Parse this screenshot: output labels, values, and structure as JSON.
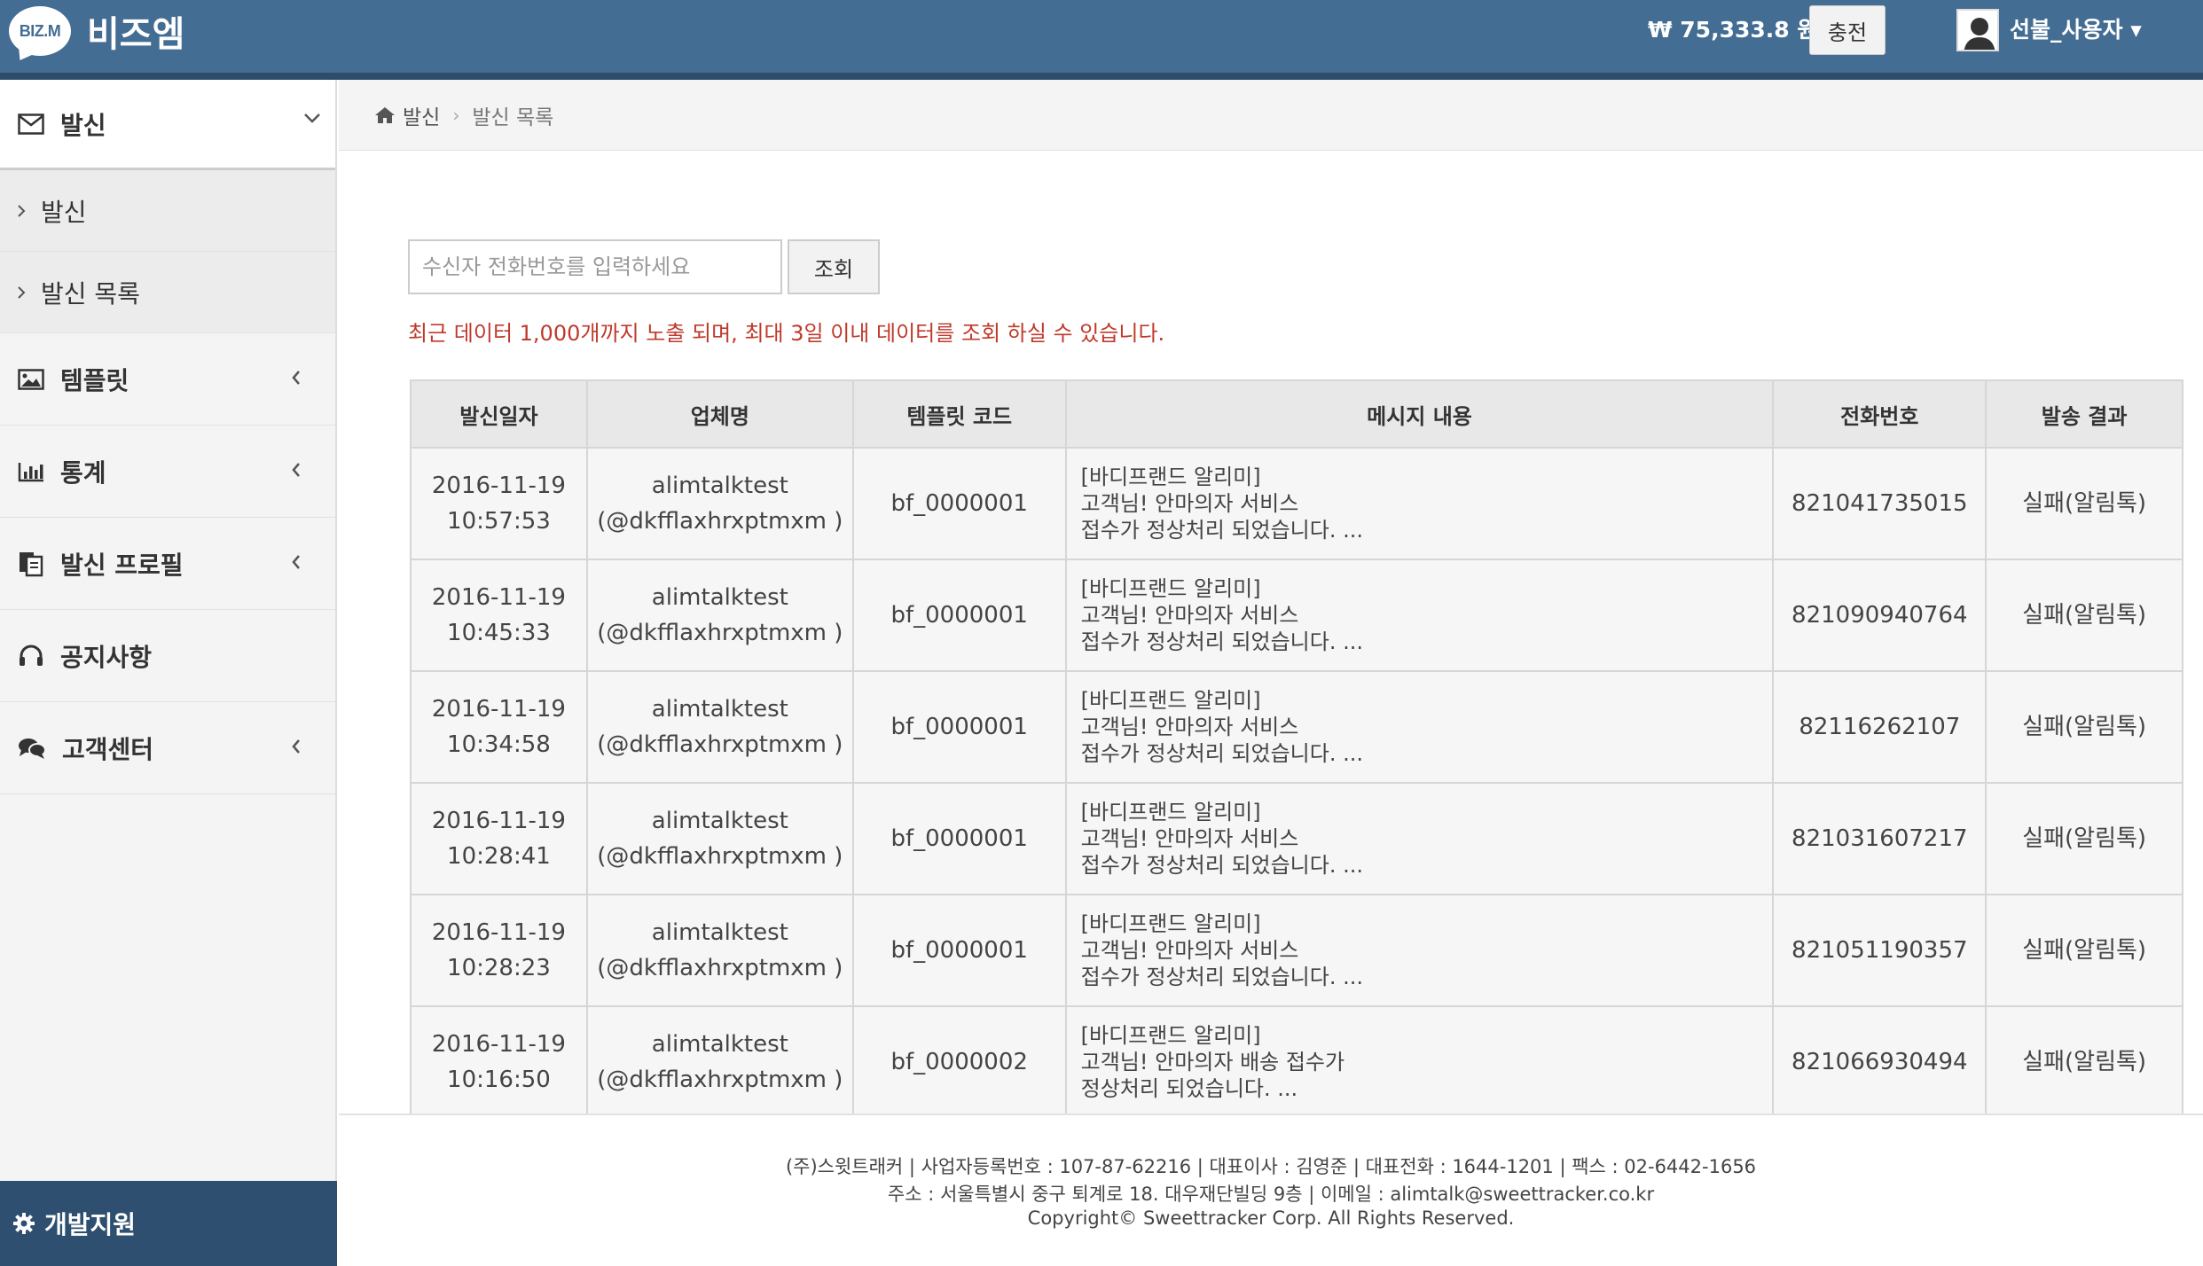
{
  "app": {
    "logo_mark": "BIZ.M",
    "logo_text": "비즈엠"
  },
  "header": {
    "balance": "₩ 75,333.8 원",
    "charge_label": "충전",
    "user_label": "선불_사용자 ▾"
  },
  "sidebar": {
    "send_section": {
      "label": "발신",
      "sub_items": [
        "발신",
        "발신 목록"
      ]
    },
    "items": [
      {
        "label": "템플릿",
        "icon": "image-icon",
        "has_chevron": true
      },
      {
        "label": "통계",
        "icon": "bar-chart-icon",
        "has_chevron": true
      },
      {
        "label": "발신 프로필",
        "icon": "document-icon",
        "has_chevron": true
      },
      {
        "label": "공지사항",
        "icon": "headset-icon",
        "has_chevron": false
      },
      {
        "label": "고객센터",
        "icon": "chat-icon",
        "has_chevron": true
      }
    ],
    "dev_support": "개발지원"
  },
  "breadcrumb": {
    "home": "발신",
    "current": "발신 목록"
  },
  "search": {
    "placeholder": "수신자 전화번호를 입력하세요",
    "button": "조회"
  },
  "notice": "최근 데이터 1,000개까지 노출 되며, 최대 3일 이내 데이터를 조회 하실 수 있습니다.",
  "table": {
    "columns": [
      "발신일자",
      "업체명",
      "템플릿 코드",
      "메시지 내용",
      "전화번호",
      "발송 결과"
    ],
    "rows": [
      {
        "date": "2016-11-19",
        "time": "10:57:53",
        "company": "alimtalktest",
        "company_id": "(@dkfflaxhrxptmxm )",
        "template": "bf_0000001",
        "msg1": "[바디프랜드 알리미]",
        "msg2": "고객님! 안마의자 서비스",
        "msg3": "접수가 정상처리 되었습니다. ...",
        "phone": "821041735015",
        "result": "실패(알림톡)"
      },
      {
        "date": "2016-11-19",
        "time": "10:45:33",
        "company": "alimtalktest",
        "company_id": "(@dkfflaxhrxptmxm )",
        "template": "bf_0000001",
        "msg1": "[바디프랜드 알리미]",
        "msg2": "고객님! 안마의자 서비스",
        "msg3": "접수가 정상처리 되었습니다. ...",
        "phone": "821090940764",
        "result": "실패(알림톡)"
      },
      {
        "date": "2016-11-19",
        "time": "10:34:58",
        "company": "alimtalktest",
        "company_id": "(@dkfflaxhrxptmxm )",
        "template": "bf_0000001",
        "msg1": "[바디프랜드 알리미]",
        "msg2": "고객님! 안마의자 서비스",
        "msg3": "접수가 정상처리 되었습니다. ...",
        "phone": "82116262107",
        "result": "실패(알림톡)"
      },
      {
        "date": "2016-11-19",
        "time": "10:28:41",
        "company": "alimtalktest",
        "company_id": "(@dkfflaxhrxptmxm )",
        "template": "bf_0000001",
        "msg1": "[바디프랜드 알리미]",
        "msg2": "고객님! 안마의자 서비스",
        "msg3": "접수가 정상처리 되었습니다. ...",
        "phone": "821031607217",
        "result": "실패(알림톡)"
      },
      {
        "date": "2016-11-19",
        "time": "10:28:23",
        "company": "alimtalktest",
        "company_id": "(@dkfflaxhrxptmxm )",
        "template": "bf_0000001",
        "msg1": "[바디프랜드 알리미]",
        "msg2": "고객님! 안마의자 서비스",
        "msg3": "접수가 정상처리 되었습니다. ...",
        "phone": "821051190357",
        "result": "실패(알림톡)"
      },
      {
        "date": "2016-11-19",
        "time": "10:16:50",
        "company": "alimtalktest",
        "company_id": "(@dkfflaxhrxptmxm )",
        "template": "bf_0000002",
        "msg1": "[바디프랜드 알리미]",
        "msg2": "고객님! 안마의자 배송 접수가",
        "msg3": "정상처리 되었습니다. ...",
        "phone": "821066930494",
        "result": "실패(알림톡)"
      }
    ]
  },
  "footer": {
    "line1": "(주)스윗트래커  |  사업자등록번호 : 107-87-62216  |  대표이사 : 김영준  |  대표전화 : 1644-1201  |  팩스 : 02-6442-1656",
    "line2": "주소 : 서울특별시 중구 퇴계로 18. 대우재단빌딩 9층  |  이메일 : alimtalk@sweettracker.co.kr",
    "line3": "Copyright© Sweettracker Corp. All Rights Reserved."
  },
  "colors": {
    "header_bg": "#436d93",
    "header_strip": "#2e4d6b",
    "dev_support_bg": "#2e4f70",
    "notice_text": "#c0392b"
  }
}
